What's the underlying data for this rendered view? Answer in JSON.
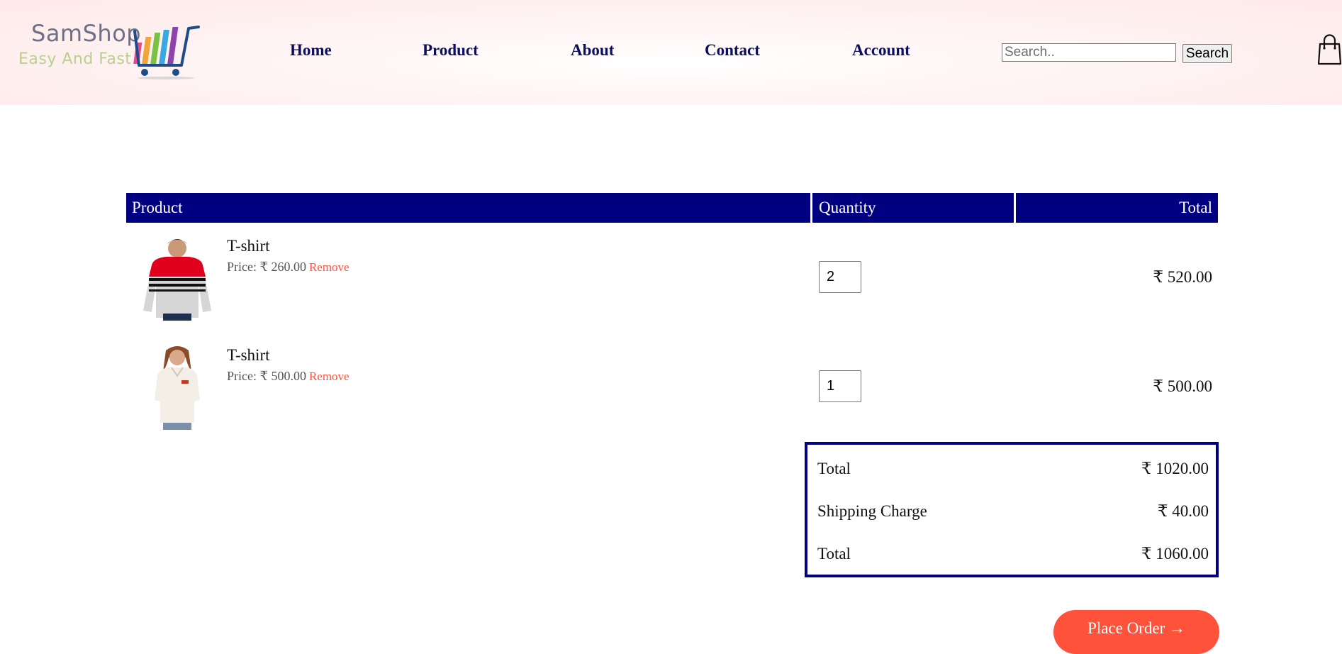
{
  "brand": {
    "name": "SamShop",
    "tagline": "Easy And Fast"
  },
  "nav": {
    "items": [
      "Home",
      "Product",
      "About",
      "Contact",
      "Account"
    ]
  },
  "search": {
    "placeholder": "Search..",
    "button_label": "Search"
  },
  "cart": {
    "headers": {
      "product": "Product",
      "quantity": "Quantity",
      "total": "Total"
    },
    "items": [
      {
        "name": "T-shirt",
        "price": "Price: ₹ 260.00",
        "remove_label": "Remove",
        "quantity": "2",
        "total": "₹ 520.00"
      },
      {
        "name": "T-shirt",
        "price": "Price: ₹ 500.00",
        "remove_label": "Remove",
        "quantity": "1",
        "total": "₹ 500.00"
      }
    ]
  },
  "summary": {
    "rows": [
      {
        "label": "Total",
        "value": "₹ 1020.00"
      },
      {
        "label": "Shipping Charge",
        "value": "₹ 40.00"
      },
      {
        "label": "Total",
        "value": "₹ 1060.00"
      }
    ]
  },
  "place_order_label": "Place Order →",
  "colors": {
    "accent": "#ff523b",
    "navy": "#000080",
    "nav_text": "#0e0e5e",
    "logo_text": "#6f6f86",
    "tagline": "#b9cf8c"
  }
}
